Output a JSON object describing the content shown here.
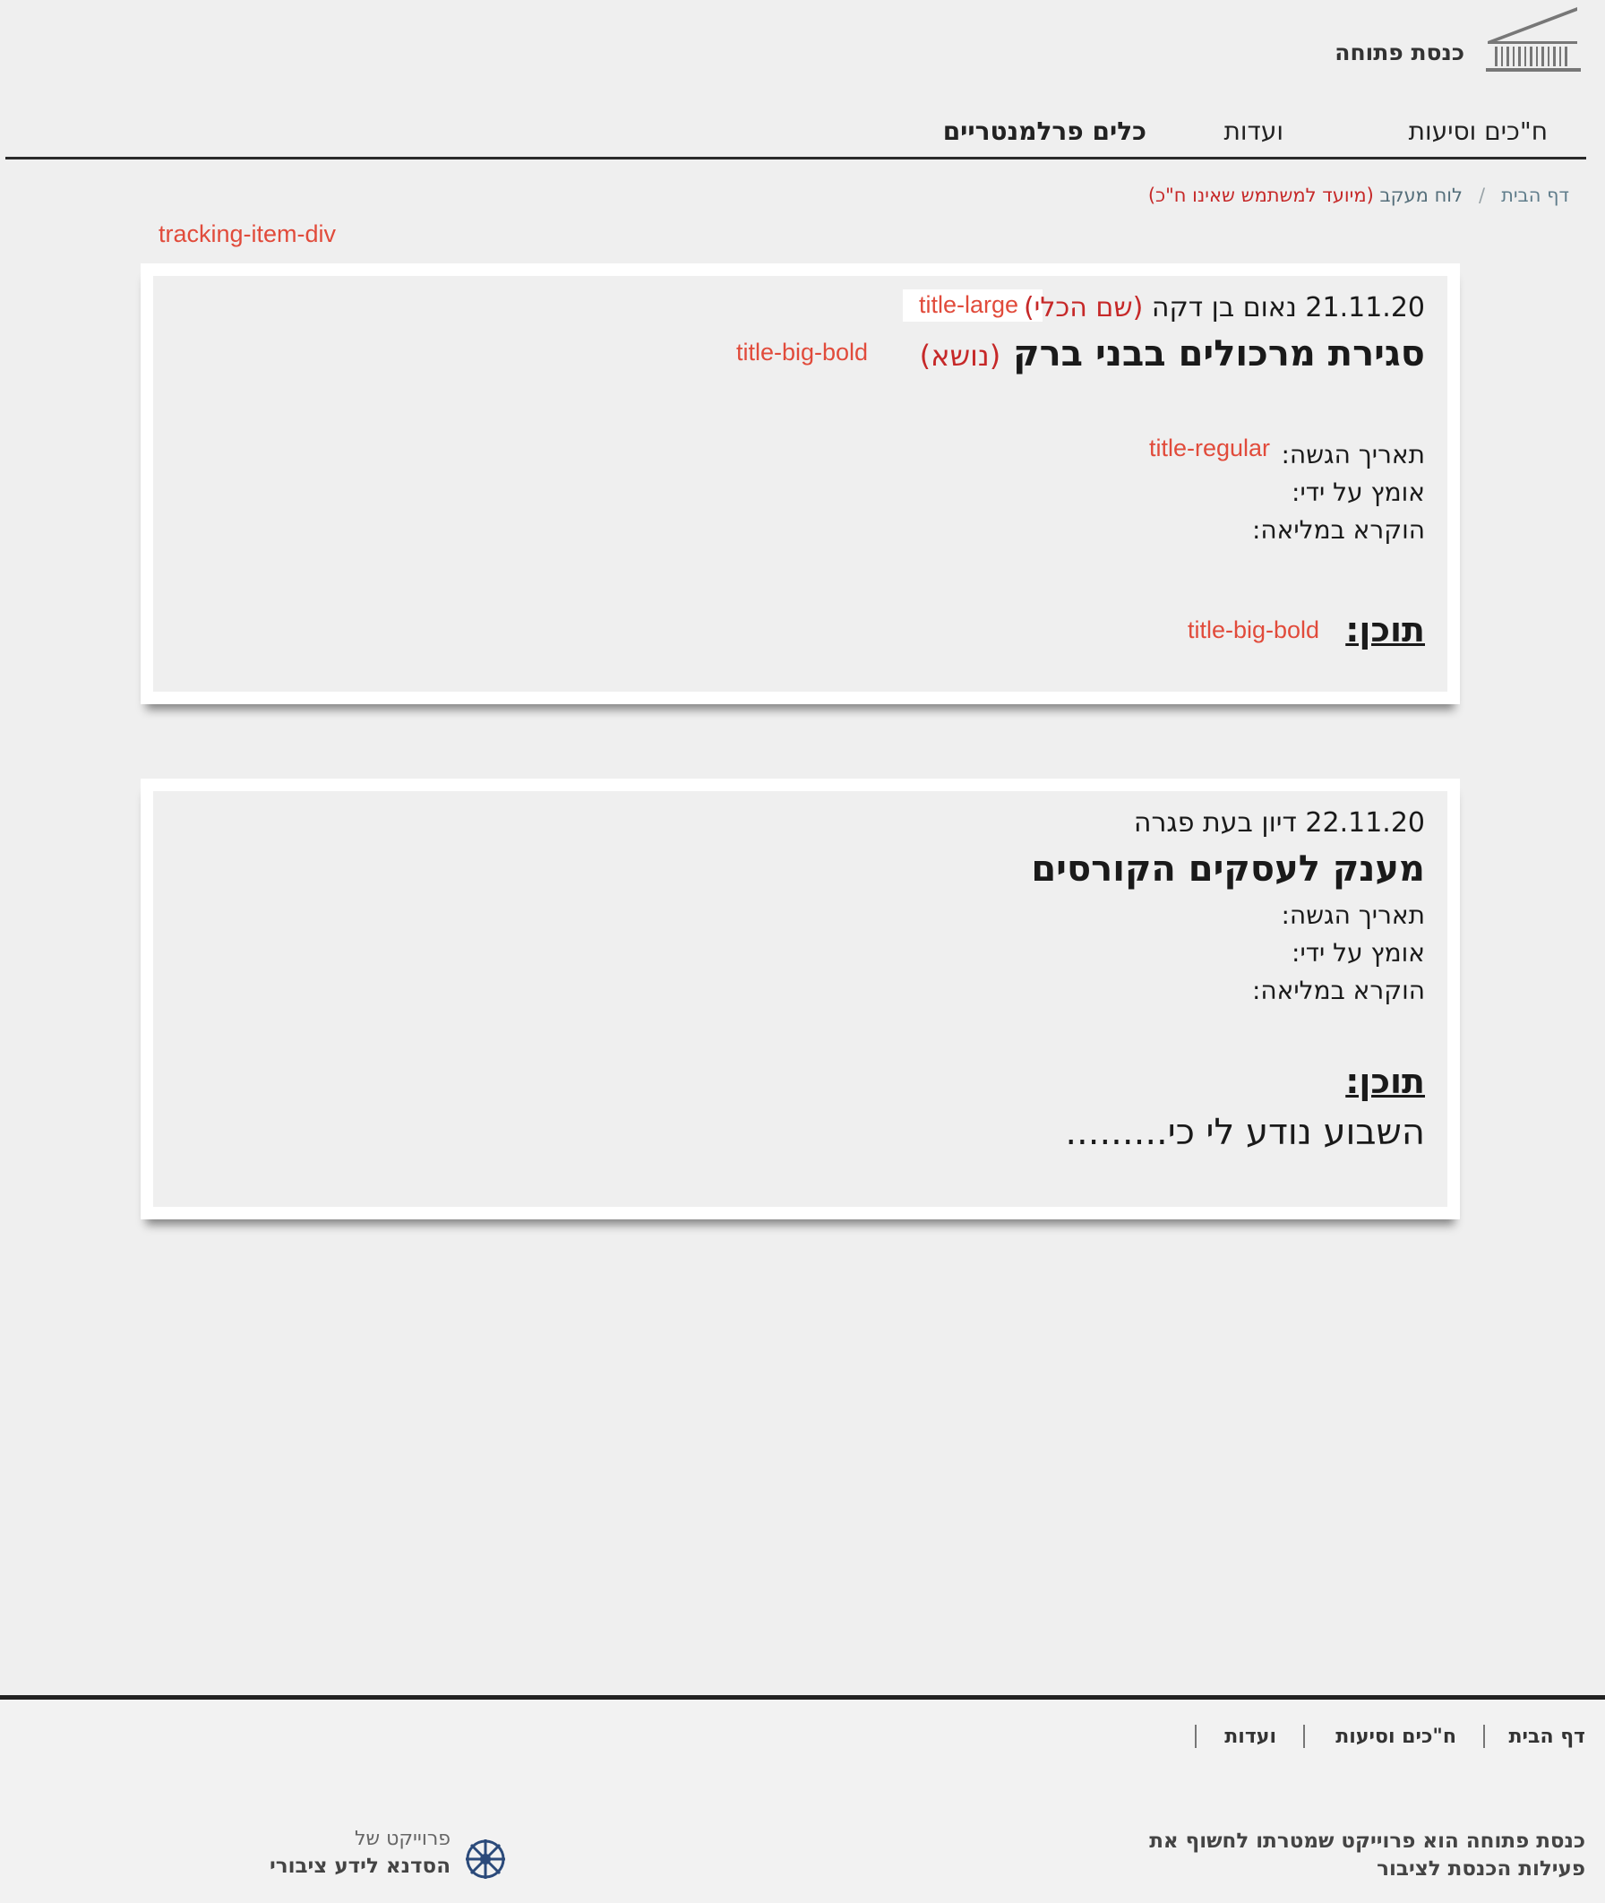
{
  "header": {
    "site_title": "כנסת פתוחה",
    "nav": [
      "ח\"כים וסיעות",
      "ועדות",
      "כלים פרלמנטריים"
    ]
  },
  "breadcrumb": {
    "home": "דף הבית",
    "separator": "/",
    "current": "לוח מעקב",
    "note": "(מיועד למשתמש שאינו ח\"כ)"
  },
  "annotations": {
    "tracking_item_div": "tracking-item-div",
    "title_large": "title-large",
    "title_big_bold": "title-big-bold",
    "title_regular": "title-regular",
    "title_big_bold_2": "title-big-bold"
  },
  "items": [
    {
      "date": "21.11.20",
      "speaker": "נאום בן דקה",
      "tool_tag": "(שם הכלי)",
      "subject": "סגירת מרכולים בבני ברק",
      "subject_tag": "(נושא)",
      "submitted_label": "תאריך הגשה:",
      "adopted_label": "אומץ על ידי:",
      "plenum_label": "הוקרא במליאה:",
      "content_title": "תוכן:",
      "content_body": ""
    },
    {
      "date": "22.11.20",
      "speaker": "דיון בעת פגרה",
      "subject": "מענק לעסקים הקורסים",
      "submitted_label": "תאריך הגשה:",
      "adopted_label": "אומץ על ידי:",
      "plenum_label": "הוקרא במליאה:",
      "content_title": "תוכן:",
      "content_body": "השבוע נודע לי כי........."
    }
  ],
  "footer": {
    "links": [
      "דף הבית",
      "ח\"כים וסיעות",
      "ועדות"
    ],
    "description_line1": "כנסת פתוחה הוא פרוייקט שמטרתו לחשוף את",
    "description_line2": "פעילות הכנסת לציבור",
    "project_of": "פרוייקט של",
    "hasadna": "הסדנא לידע ציבורי"
  },
  "colors": {
    "accent_red": "#c62828",
    "annotation_red": "#e14b3b",
    "background": "#efefef"
  }
}
